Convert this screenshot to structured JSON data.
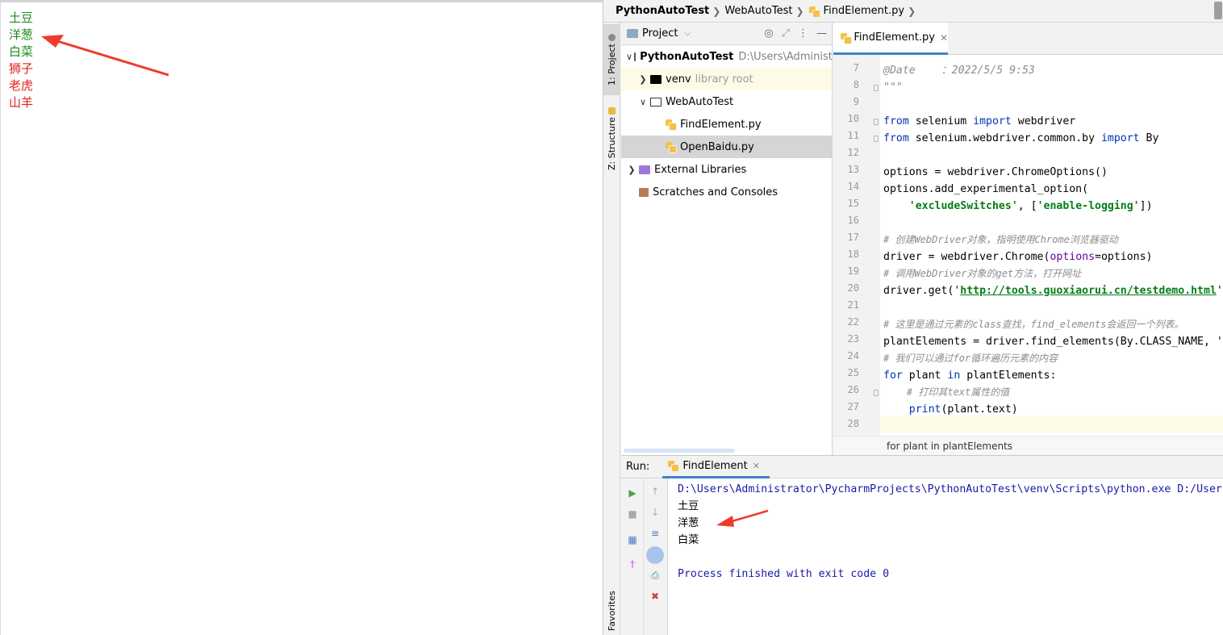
{
  "browser": {
    "plants": [
      {
        "text": "土豆",
        "color": "#1e8a1e"
      },
      {
        "text": "洋葱",
        "color": "#1e8a1e"
      },
      {
        "text": "白菜",
        "color": "#1e8a1e"
      },
      {
        "text": "狮子",
        "color": "#e02020"
      },
      {
        "text": "老虎",
        "color": "#e02020"
      },
      {
        "text": "山羊",
        "color": "#e02020"
      }
    ]
  },
  "ide": {
    "breadcrumbs": {
      "project": "PythonAutoTest",
      "folder": "WebAutoTest",
      "file": "FindElement.py"
    },
    "side_tabs": {
      "project": "1: Project",
      "structure": "Z: Structure",
      "favorites": "Favorites"
    },
    "project_panel": {
      "title": "Project",
      "root_name": "PythonAutoTest",
      "root_path": "D:\\Users\\Administra",
      "venv": "venv",
      "venv_tag": "library root",
      "folder": "WebAutoTest",
      "file1": "FindElement.py",
      "file2": "OpenBaidu.py",
      "external": "External Libraries",
      "scratches": "Scratches and Consoles"
    },
    "editor": {
      "tab_label": "FindElement.py",
      "line_numbers": [
        "7",
        "8",
        "9",
        "10",
        "11",
        "12",
        "13",
        "14",
        "15",
        "16",
        "17",
        "18",
        "19",
        "20",
        "21",
        "22",
        "23",
        "24",
        "25",
        "26",
        "27",
        "28"
      ],
      "lines": {
        "l7a": "@Date",
        "l7b": "    ：2022/5/5 9:53",
        "l8": "\"\"\"",
        "l10a": "from",
        "l10b": " selenium ",
        "l10c": "import",
        "l10d": " webdriver",
        "l11a": "from",
        "l11b": " selenium.webdriver.common.by ",
        "l11c": "import",
        "l11d": " By",
        "l13": "options = webdriver.ChromeOptions()",
        "l14": "options.add_experimental_option(",
        "l15a": "    ",
        "l15b": "'excludeSwitches'",
        "l15c": ", [",
        "l15d": "'enable-logging'",
        "l15e": "])",
        "l17": "# 创建WebDriver对象，指明使用Chrome浏览器驱动",
        "l18a": "driver = webdriver.Chrome(",
        "l18b": "options",
        "l18c": "=options)",
        "l19": "# 调用WebDriver对象的get方法，打开网址",
        "l20a": "driver.get(",
        "l20b": "'",
        "l20c": "http://tools.guoxiaorui.cn/testdemo.html",
        "l20d": "'",
        "l22": "# 这里是通过元素的class查找，find_elements会返回一个列表。",
        "l23a": "plantElements = driver.find_elements(By.CLASS_NAME, ",
        "l23b": "'",
        "l24": "# 我们可以通过for循环遍历元素的内容",
        "l25a": "for",
        "l25b": " plant ",
        "l25c": "in",
        "l25d": " plantElements:",
        "l26": "    # 打印其text属性的值",
        "l27a": "    ",
        "l27b": "print",
        "l27c": "(plant.text)"
      },
      "breadcrumb_bottom": "for plant in plantElements"
    },
    "run_panel": {
      "title": "Run:",
      "tab": "FindElement",
      "output": {
        "cmd": "D:\\Users\\Administrator\\PycharmProjects\\PythonAutoTest\\venv\\Scripts\\python.exe D:/Users",
        "out1": "土豆",
        "out2": "洋葱",
        "out3": "白菜",
        "finish": "Process finished with exit code 0"
      }
    }
  }
}
